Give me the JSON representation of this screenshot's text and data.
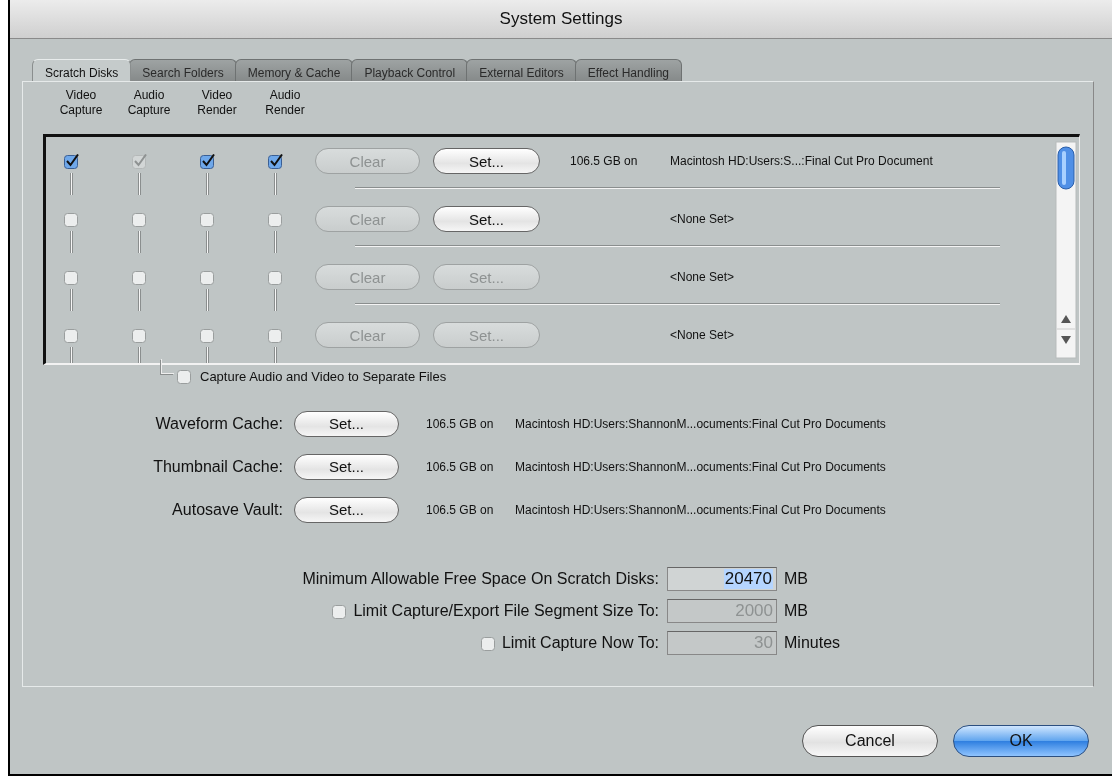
{
  "window": {
    "title": "System Settings"
  },
  "tabs": [
    {
      "label": "Scratch Disks",
      "selected": true
    },
    {
      "label": "Search Folders",
      "selected": false
    },
    {
      "label": "Memory & Cache",
      "selected": false
    },
    {
      "label": "Playback Control",
      "selected": false
    },
    {
      "label": "External Editors",
      "selected": false
    },
    {
      "label": "Effect Handling",
      "selected": false
    }
  ],
  "scratch_columns": [
    "Video Capture",
    "Audio Capture",
    "Video Render",
    "Audio Render"
  ],
  "scratch_disks": [
    {
      "checks": [
        {
          "checked": true,
          "disabled": false
        },
        {
          "checked": true,
          "disabled": true
        },
        {
          "checked": true,
          "disabled": false
        },
        {
          "checked": true,
          "disabled": false
        }
      ],
      "clear": {
        "label": "Clear",
        "disabled": true
      },
      "set": {
        "label": "Set...",
        "disabled": false
      },
      "size": "106.5 GB on",
      "path": "Macintosh HD:Users:S...:Final Cut Pro Document"
    },
    {
      "checks": [
        {
          "checked": false,
          "disabled": false
        },
        {
          "checked": false,
          "disabled": false
        },
        {
          "checked": false,
          "disabled": false
        },
        {
          "checked": false,
          "disabled": false
        }
      ],
      "clear": {
        "label": "Clear",
        "disabled": true
      },
      "set": {
        "label": "Set...",
        "disabled": false
      },
      "path": "<None Set>"
    },
    {
      "checks": [
        {
          "checked": false,
          "disabled": false
        },
        {
          "checked": false,
          "disabled": false
        },
        {
          "checked": false,
          "disabled": false
        },
        {
          "checked": false,
          "disabled": false
        }
      ],
      "clear": {
        "label": "Clear",
        "disabled": true
      },
      "set": {
        "label": "Set...",
        "disabled": true
      },
      "path": "<None Set>"
    },
    {
      "checks": [
        {
          "checked": false,
          "disabled": false
        },
        {
          "checked": false,
          "disabled": false
        },
        {
          "checked": false,
          "disabled": false
        },
        {
          "checked": false,
          "disabled": false
        }
      ],
      "clear": {
        "label": "Clear",
        "disabled": true
      },
      "set": {
        "label": "Set...",
        "disabled": true
      },
      "path": "<None Set>"
    }
  ],
  "separate_files": {
    "label": "Capture Audio and Video to Separate Files",
    "checked": false
  },
  "caches": [
    {
      "label": "Waveform Cache:",
      "button": "Set...",
      "size": "106.5 GB on",
      "path": "Macintosh HD:Users:ShannonM...ocuments:Final Cut Pro Documents"
    },
    {
      "label": "Thumbnail Cache:",
      "button": "Set...",
      "size": "106.5 GB on",
      "path": "Macintosh HD:Users:ShannonM...ocuments:Final Cut Pro Documents"
    },
    {
      "label": "Autosave Vault:",
      "button": "Set...",
      "size": "106.5 GB on",
      "path": "Macintosh HD:Users:ShannonM...ocuments:Final Cut Pro Documents"
    }
  ],
  "limits": [
    {
      "kind": "plain",
      "label": "Minimum Allowable Free Space On Scratch Disks:",
      "value": "20470",
      "disabled": false,
      "selected": true,
      "unit": "MB"
    },
    {
      "kind": "checkbox",
      "checked": false,
      "label": "Limit Capture/Export File Segment Size To:",
      "value": "2000",
      "disabled": true,
      "selected": false,
      "unit": "MB"
    },
    {
      "kind": "checkbox",
      "checked": false,
      "label": "Limit Capture Now To:",
      "value": "30",
      "disabled": true,
      "selected": false,
      "unit": "Minutes"
    }
  ],
  "buttons": [
    {
      "label": "Cancel",
      "default": false
    },
    {
      "label": "OK",
      "default": true
    }
  ]
}
